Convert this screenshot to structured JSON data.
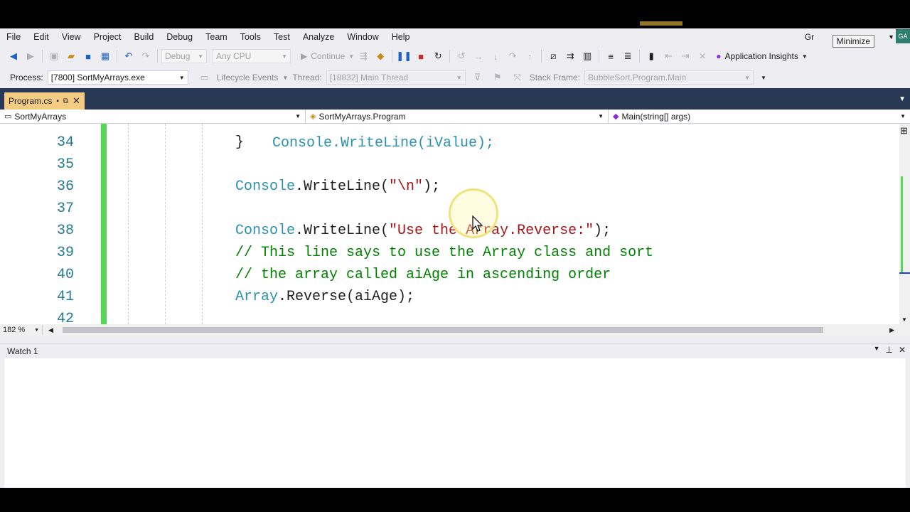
{
  "menu": {
    "items": [
      "File",
      "Edit",
      "View",
      "Project",
      "Build",
      "Debug",
      "Team",
      "Tools",
      "Test",
      "Analyze",
      "Window",
      "Help"
    ],
    "account_name": "Gr",
    "account_initials": "GA",
    "tooltip": "Minimize"
  },
  "toolbar1": {
    "config": "Debug",
    "platform": "Any CPU",
    "continue_label": "Continue",
    "app_insights": "Application Insights"
  },
  "toolbar2": {
    "process_label": "Process:",
    "process_value": "[7800] SortMyArrays.exe",
    "lifecycle_label": "Lifecycle Events",
    "thread_label": "Thread:",
    "thread_value": "[18832] Main Thread",
    "stackframe_label": "Stack Frame:",
    "stackframe_value": "BubbleSort.Program.Main"
  },
  "tab": {
    "filename": "Program.cs"
  },
  "navbar": {
    "project": "SortMyArrays",
    "class": "SortMyArrays.Program",
    "member": "Main(string[] args)"
  },
  "editor": {
    "partial_top": "Console.WriteLine(iValue);",
    "lines": [
      {
        "num": "34",
        "tokens": [
          {
            "c": "plain",
            "t": "}"
          }
        ]
      },
      {
        "num": "35",
        "tokens": []
      },
      {
        "num": "36",
        "tokens": [
          {
            "c": "type",
            "t": "Console"
          },
          {
            "c": "plain",
            "t": ".WriteLine("
          },
          {
            "c": "str",
            "t": "\"\\n\""
          },
          {
            "c": "plain",
            "t": ");"
          }
        ]
      },
      {
        "num": "37",
        "tokens": []
      },
      {
        "num": "38",
        "tokens": [
          {
            "c": "type",
            "t": "Console"
          },
          {
            "c": "plain",
            "t": ".WriteLine("
          },
          {
            "c": "str",
            "t": "\"Use the Array.Reverse:\""
          },
          {
            "c": "plain",
            "t": ");"
          }
        ]
      },
      {
        "num": "39",
        "tokens": [
          {
            "c": "cmt",
            "t": "// This line says to use the Array class and sort"
          }
        ]
      },
      {
        "num": "40",
        "tokens": [
          {
            "c": "cmt",
            "t": "// the array called aiAge in ascending order"
          }
        ]
      },
      {
        "num": "41",
        "tokens": [
          {
            "c": "type",
            "t": "Array"
          },
          {
            "c": "plain",
            "t": ".Reverse(aiAge);"
          }
        ]
      },
      {
        "num": "42",
        "tokens": []
      }
    ],
    "zoom": "182 %"
  },
  "watch": {
    "title": "Watch 1"
  }
}
